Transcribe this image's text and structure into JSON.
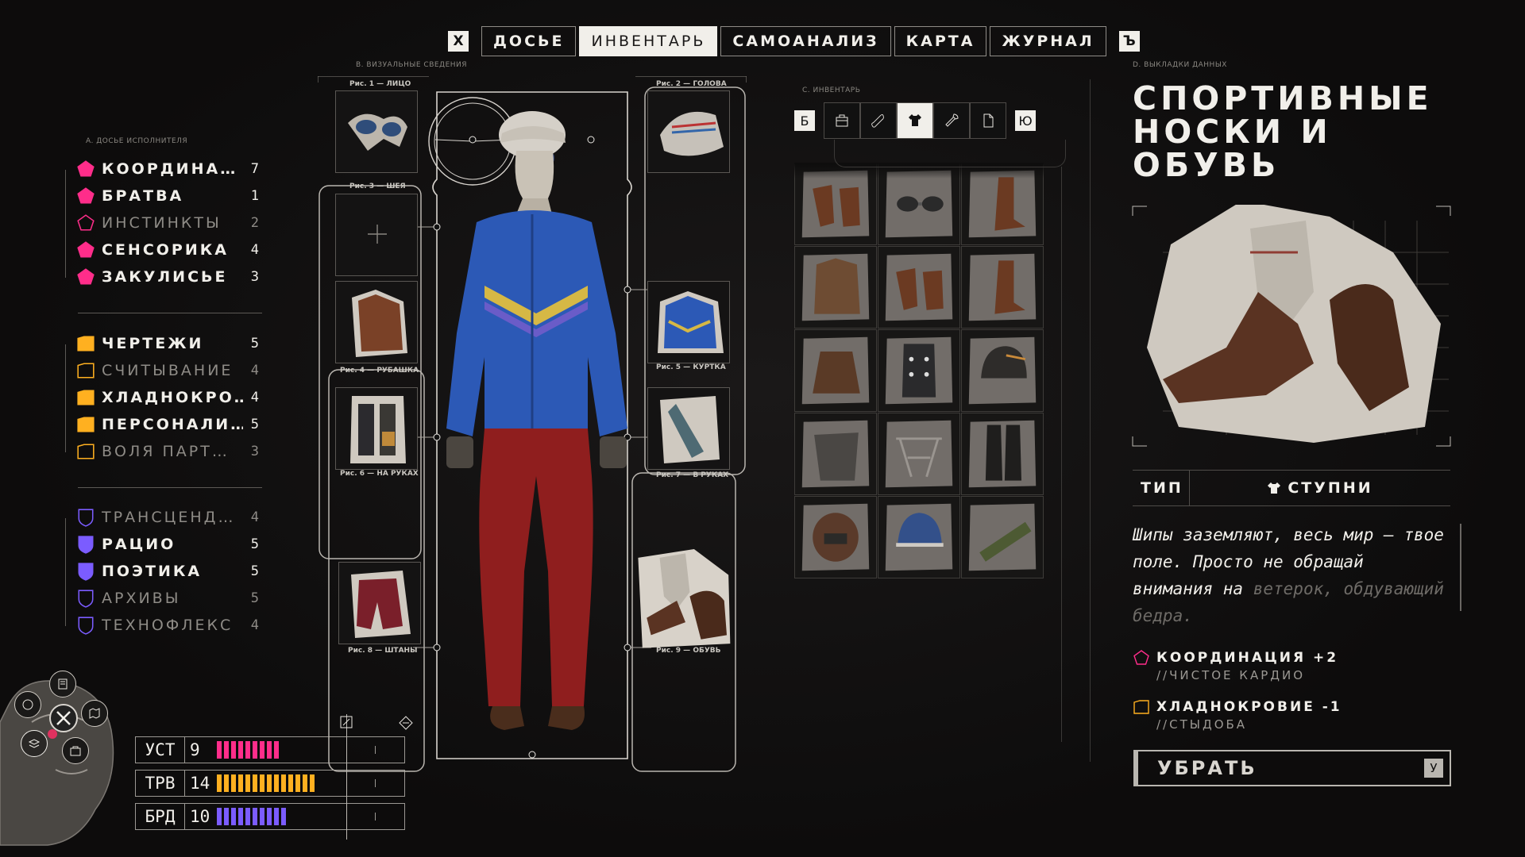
{
  "tabs": {
    "left_key": "Х",
    "right_key": "Ъ",
    "items": [
      {
        "label": "ДОСЬЕ",
        "active": false
      },
      {
        "label": "ИНВЕНТАРЬ",
        "active": true
      },
      {
        "label": "САМОАНАЛИЗ",
        "active": false
      },
      {
        "label": "КАРТА",
        "active": false
      },
      {
        "label": "ЖУРНАЛ",
        "active": false
      }
    ]
  },
  "sections": {
    "dossier": "A. ДОСЬЕ ИСПОЛНИТЕЛЯ",
    "visual": "B. ВИЗУАЛЬНЫЕ СВЕДЕНИЯ",
    "inventory": "C. ИНВЕНТАРЬ",
    "data": "D. ВЫКЛАДКИ ДАННЫХ"
  },
  "stats": {
    "groups": [
      {
        "color": "#ff2d8a",
        "shape": "pentagon",
        "items": [
          {
            "label": "КООРДИНА…",
            "value": "7",
            "filled": true
          },
          {
            "label": "БРАТВА",
            "value": "1",
            "filled": true
          },
          {
            "label": "ИНСТИНКТЫ",
            "value": "2",
            "filled": false
          },
          {
            "label": "СЕНСОРИКА",
            "value": "4",
            "filled": true
          },
          {
            "label": "ЗАКУЛИСЬЕ",
            "value": "3",
            "filled": true
          }
        ]
      },
      {
        "color": "#ffb020",
        "shape": "folder",
        "items": [
          {
            "label": "ЧЕРТЕЖИ",
            "value": "5",
            "filled": true
          },
          {
            "label": "СЧИТЫВАНИЕ",
            "value": "4",
            "filled": false
          },
          {
            "label": "ХЛАДНОКРО…",
            "value": "4",
            "filled": true
          },
          {
            "label": "ПЕРСОНАЛИ…",
            "value": "5",
            "filled": true
          },
          {
            "label": "ВОЛЯ ПАРТ…",
            "value": "3",
            "filled": false
          }
        ]
      },
      {
        "color": "#7b5cff",
        "shape": "shield",
        "items": [
          {
            "label": "ТРАНСЦЕНД…",
            "value": "4",
            "filled": false
          },
          {
            "label": "РАЦИО",
            "value": "5",
            "filled": true
          },
          {
            "label": "ПОЭТИКА",
            "value": "5",
            "filled": true
          },
          {
            "label": "АРХИВЫ",
            "value": "5",
            "filled": false
          },
          {
            "label": "ТЕХНОФЛЕКС",
            "value": "4",
            "filled": false
          }
        ]
      }
    ]
  },
  "bars": [
    {
      "label": "УСТ",
      "value": "9",
      "ticks": 9,
      "color": "#ff2d8a"
    },
    {
      "label": "ТРВ",
      "value": "14",
      "ticks": 14,
      "color": "#ffb020"
    },
    {
      "label": "БРД",
      "value": "10",
      "ticks": 10,
      "color": "#7b5cff"
    }
  ],
  "paper_doll": {
    "slots": [
      {
        "caption": "Рис. 1 — ЛИЦО",
        "item": "goggles"
      },
      {
        "caption": "Рис. 2 — ГОЛОВА",
        "item": "cap"
      },
      {
        "caption": "Рис. 3 — ШЕЯ",
        "item": "empty"
      },
      {
        "caption": "Рис. 4 — РУБАШКА",
        "item": "shirt"
      },
      {
        "caption": "Рис. 5 — КУРТКА",
        "item": "jacket"
      },
      {
        "caption": "Рис. 6 — НА РУКАХ",
        "item": "gloves"
      },
      {
        "caption": "Рис. 7 — В РУКАХ",
        "item": "tool"
      },
      {
        "caption": "Рис. 8 — ШТАНЫ",
        "item": "pants"
      },
      {
        "caption": "Рис. 9 — ОБУВЬ",
        "item": "shoes"
      }
    ]
  },
  "inventory": {
    "left_key": "Б",
    "right_key": "Ю",
    "filters": [
      {
        "icon": "bag-icon",
        "active": false
      },
      {
        "icon": "pill-icon",
        "active": false
      },
      {
        "icon": "shirt-icon",
        "active": true
      },
      {
        "icon": "wrench-icon",
        "active": false
      },
      {
        "icon": "paper-icon",
        "active": false
      }
    ],
    "items": [
      "boots",
      "goggles",
      "boot",
      "jacket",
      "boots",
      "boot",
      "skirt",
      "spiked-glove",
      "helmet",
      "apron",
      "harness",
      "tall-boots",
      "mask",
      "beanie",
      "sandals"
    ]
  },
  "detail": {
    "title_lines": [
      "СПОРТИВНЫЕ",
      "НОСКИ И",
      "ОБУВЬ"
    ],
    "type_label": "ТИП",
    "type_value": "СТУПНИ",
    "description": "Шипы заземляют, весь мир — твое поле. Просто не обращай внимания на",
    "description_fade": "ветерок, обдувающий бедра.",
    "modifiers": [
      {
        "text": "КООРДИНАЦИЯ +2",
        "sub": "//ЧИСТОЕ КАРДИО",
        "color": "#ff2d8a",
        "shape": "pentagon"
      },
      {
        "text": "ХЛАДНОКРОВИЕ -1",
        "sub": "//СТЫДОБА",
        "color": "#ffb020",
        "shape": "folder"
      }
    ],
    "remove_label": "УБРАТЬ",
    "remove_key": "У"
  }
}
